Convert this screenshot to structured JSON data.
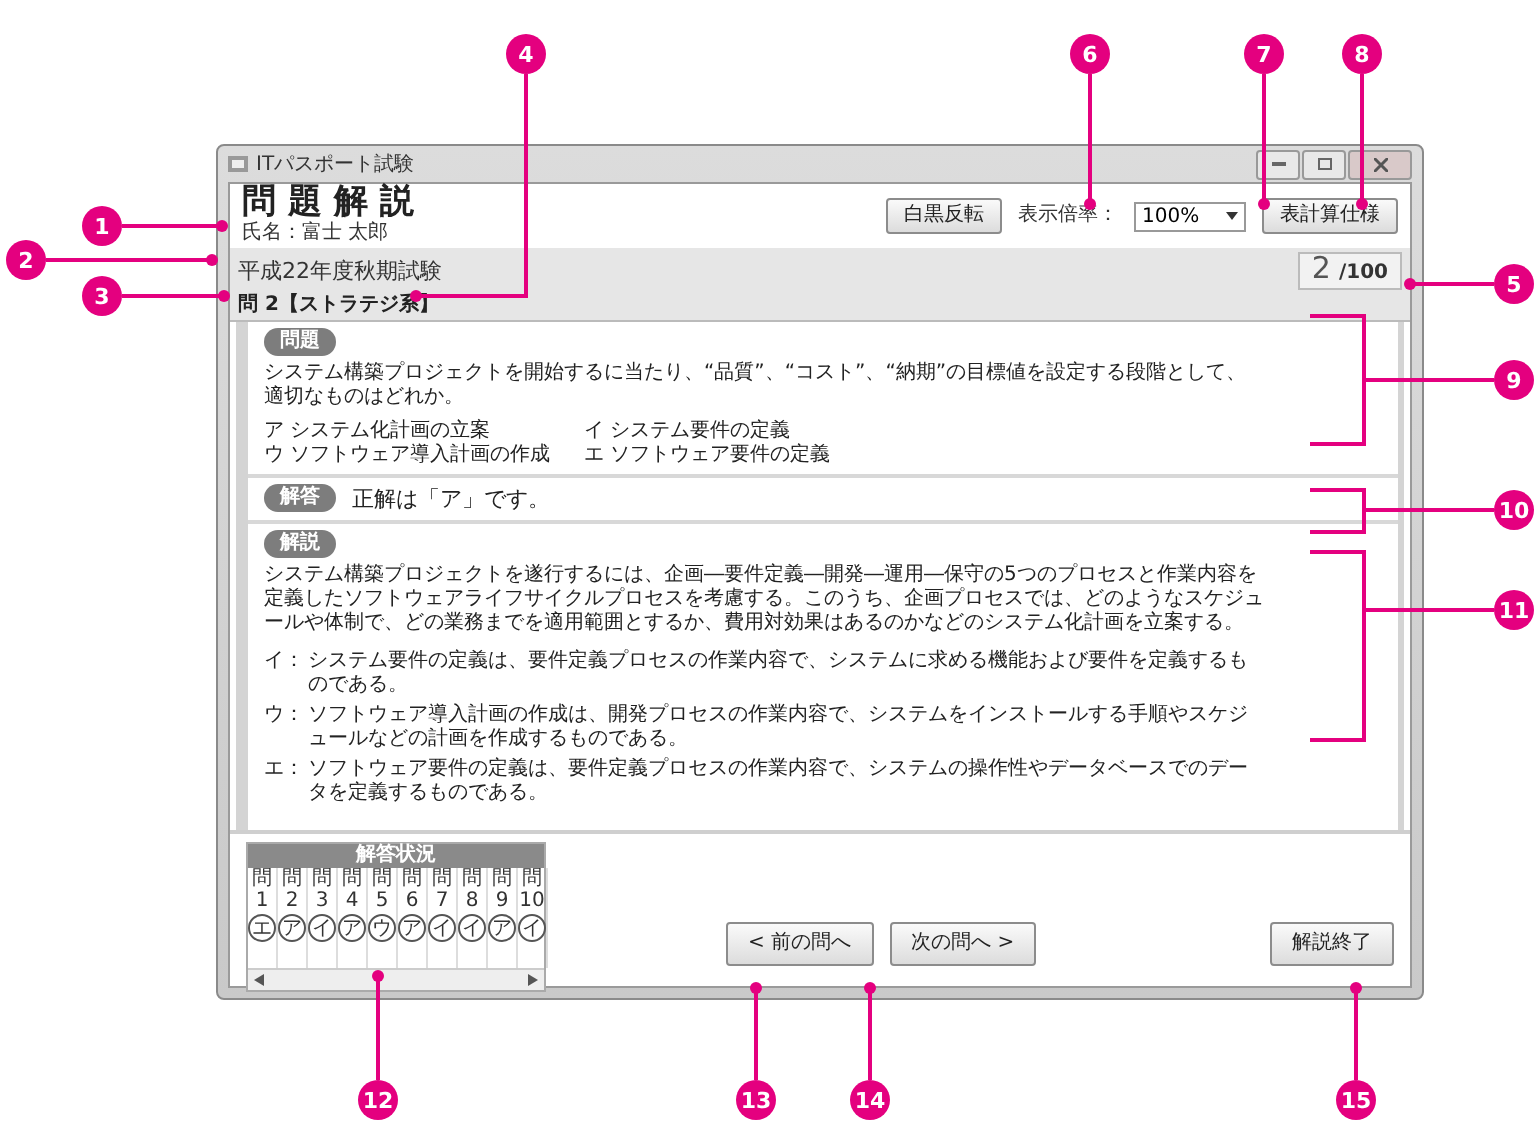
{
  "window": {
    "title": "ITパスポート試験"
  },
  "header": {
    "title": "問 題 解 説",
    "name": "氏名：富士 太郎"
  },
  "toolbar": {
    "invert_button": "白黒反転",
    "zoom_label": "表示倍率：",
    "zoom_value": "100%",
    "spec_button": "表計算仕様"
  },
  "exam": {
    "name": "平成22年度秋期試験",
    "question_label": "問 2【ストラテジ系】",
    "current": "2",
    "total": "/100"
  },
  "question": {
    "tag": "問題",
    "text": "システム構築プロジェクトを開始するに当たり、“品質”、“コスト”、“納期”の目標値を設定する段階として、適切なものはどれか。",
    "choices": [
      {
        "mark": "ア",
        "text": "システム化計画の立案"
      },
      {
        "mark": "イ",
        "text": "システム要件の定義"
      },
      {
        "mark": "ウ",
        "text": "ソフトウェア導入計画の作成"
      },
      {
        "mark": "エ",
        "text": "ソフトウェア要件の定義"
      }
    ]
  },
  "answer": {
    "tag": "解答",
    "text": "正解は「ア」です。"
  },
  "explanation": {
    "tag": "解説",
    "paragraph": "システム構築プロジェクトを遂行するには、企画―要件定義―開発―運用―保守の5つのプロセスと作業内容を定義したソフトウェアライフサイクルプロセスを考慮する。このうち、企画プロセスでは、どのようなスケジュールや体制で、どの業務までを適用範囲とするか、費用対効果はあるのかなどのシステム化計画を立案する。",
    "notes": [
      {
        "mark": "イ：",
        "text": "システム要件の定義は、要件定義プロセスの作業内容で、システムに求める機能および要件を定義するものである。"
      },
      {
        "mark": "ウ：",
        "text": "ソフトウェア導入計画の作成は、開発プロセスの作業内容で、システムをインストールする手順やスケジュールなどの計画を作成するものである。"
      },
      {
        "mark": "エ：",
        "text": "ソフトウェア要件の定義は、要件定義プロセスの作業内容で、システムの操作性やデータベースでのデータを定義するものである。"
      }
    ]
  },
  "answer_status": {
    "title": "解答状況",
    "questions": [
      {
        "label": "問",
        "number": "1",
        "answer": "エ"
      },
      {
        "label": "問",
        "number": "2",
        "answer": "ア"
      },
      {
        "label": "問",
        "number": "3",
        "answer": "イ"
      },
      {
        "label": "問",
        "number": "4",
        "answer": "ア"
      },
      {
        "label": "問",
        "number": "5",
        "answer": "ウ"
      },
      {
        "label": "問",
        "number": "6",
        "answer": "ア"
      },
      {
        "label": "問",
        "number": "7",
        "answer": "イ"
      },
      {
        "label": "問",
        "number": "8",
        "answer": "イ"
      },
      {
        "label": "問",
        "number": "9",
        "answer": "ア"
      },
      {
        "label": "問",
        "number": "10",
        "answer": "イ"
      }
    ]
  },
  "nav": {
    "prev": "< 前の問へ",
    "next": "次の問へ >",
    "finish": "解説終了"
  },
  "callouts": [
    {
      "number": "1"
    },
    {
      "number": "2"
    },
    {
      "number": "3"
    },
    {
      "number": "4"
    },
    {
      "number": "5"
    },
    {
      "number": "6"
    },
    {
      "number": "7"
    },
    {
      "number": "8"
    },
    {
      "number": "9"
    },
    {
      "number": "10"
    },
    {
      "number": "11"
    },
    {
      "number": "12"
    },
    {
      "number": "13"
    },
    {
      "number": "14"
    },
    {
      "number": "15"
    }
  ]
}
